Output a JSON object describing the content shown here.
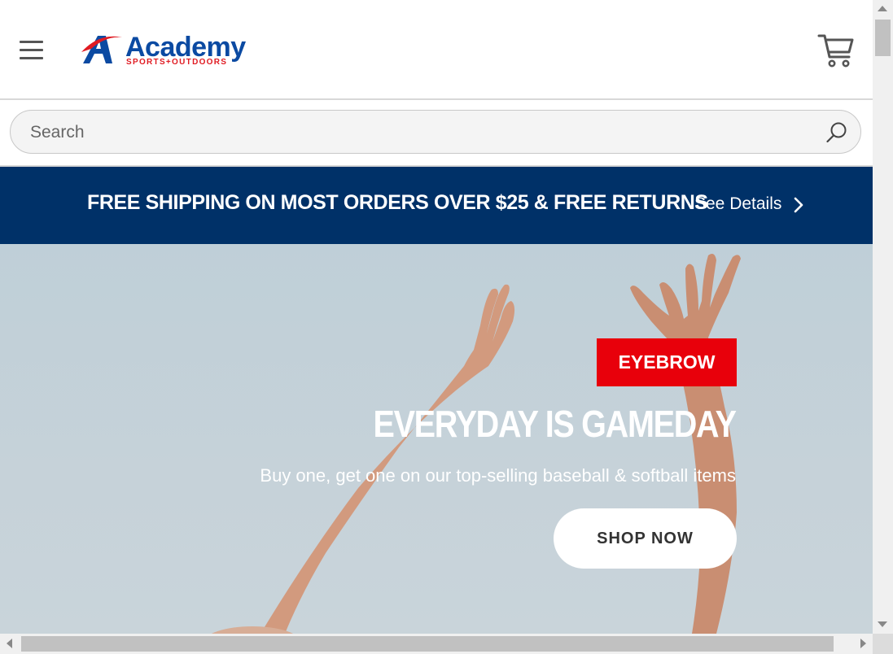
{
  "header": {
    "logo_word": "Academy",
    "logo_sub": "SPORTS+OUTDOORS",
    "menu_icon": "hamburger-menu-icon",
    "cart_icon": "shopping-cart-icon"
  },
  "search": {
    "placeholder": "Search",
    "icon": "search-icon"
  },
  "promo": {
    "text": "FREE SHIPPING ON MOST ORDERS OVER $25 & FREE RETURNS",
    "link_label": "See Details",
    "link_icon": "chevron-right-icon"
  },
  "hero": {
    "eyebrow": "EYEBROW",
    "title": "EVERYDAY IS GAMEDAY",
    "subtitle": "Buy one, get one on our top-selling baseball & softball items",
    "cta_label": "SHOP NOW"
  },
  "colors": {
    "brand_blue": "#0b4aa2",
    "brand_red": "#e01b22",
    "promo_bg": "#003168",
    "eyebrow_bg": "#e8000b",
    "hero_bg": "#c3d0d8"
  }
}
